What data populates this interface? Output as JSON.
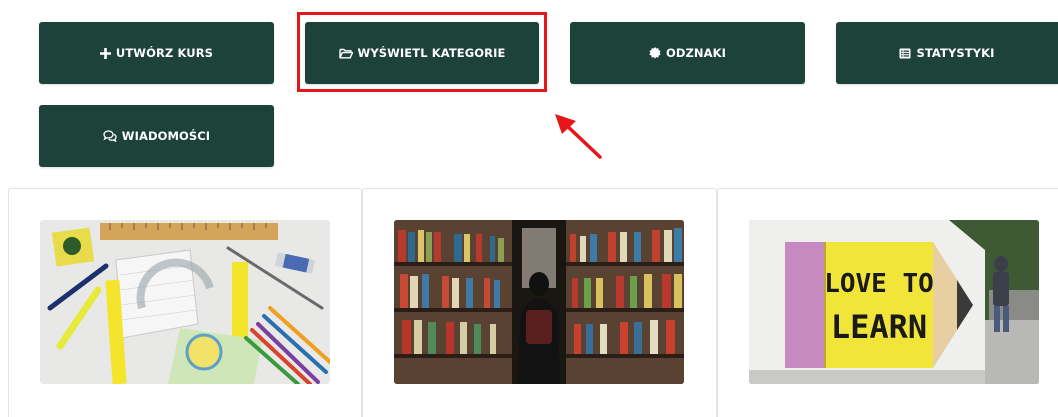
{
  "actions": {
    "create_course": {
      "label": "UTWÓRZ KURS",
      "icon": "plus-icon"
    },
    "view_categories": {
      "label": "WYŚWIETL KATEGORIE",
      "icon": "folder-open-icon"
    },
    "badges": {
      "label": "ODZNAKI",
      "icon": "badge-icon"
    },
    "statistics": {
      "label": "STATYSTYKI",
      "icon": "list-alt-icon"
    },
    "messages": {
      "label": "WIADOMOŚCI",
      "icon": "comments-icon"
    }
  },
  "annotation": {
    "highlight_color": "#e8161b",
    "arrow": "red-arrow-pointing-to-view-categories"
  },
  "colors": {
    "button_bg": "#1d4239",
    "button_text": "#ffffff"
  },
  "course_cards": [
    {
      "image": "school-supplies-photo"
    },
    {
      "image": "library-bookshelves-photo"
    },
    {
      "image": "love-to-learn-pencil-sign-photo",
      "sign_text": "LOVE TO LEARN"
    }
  ]
}
